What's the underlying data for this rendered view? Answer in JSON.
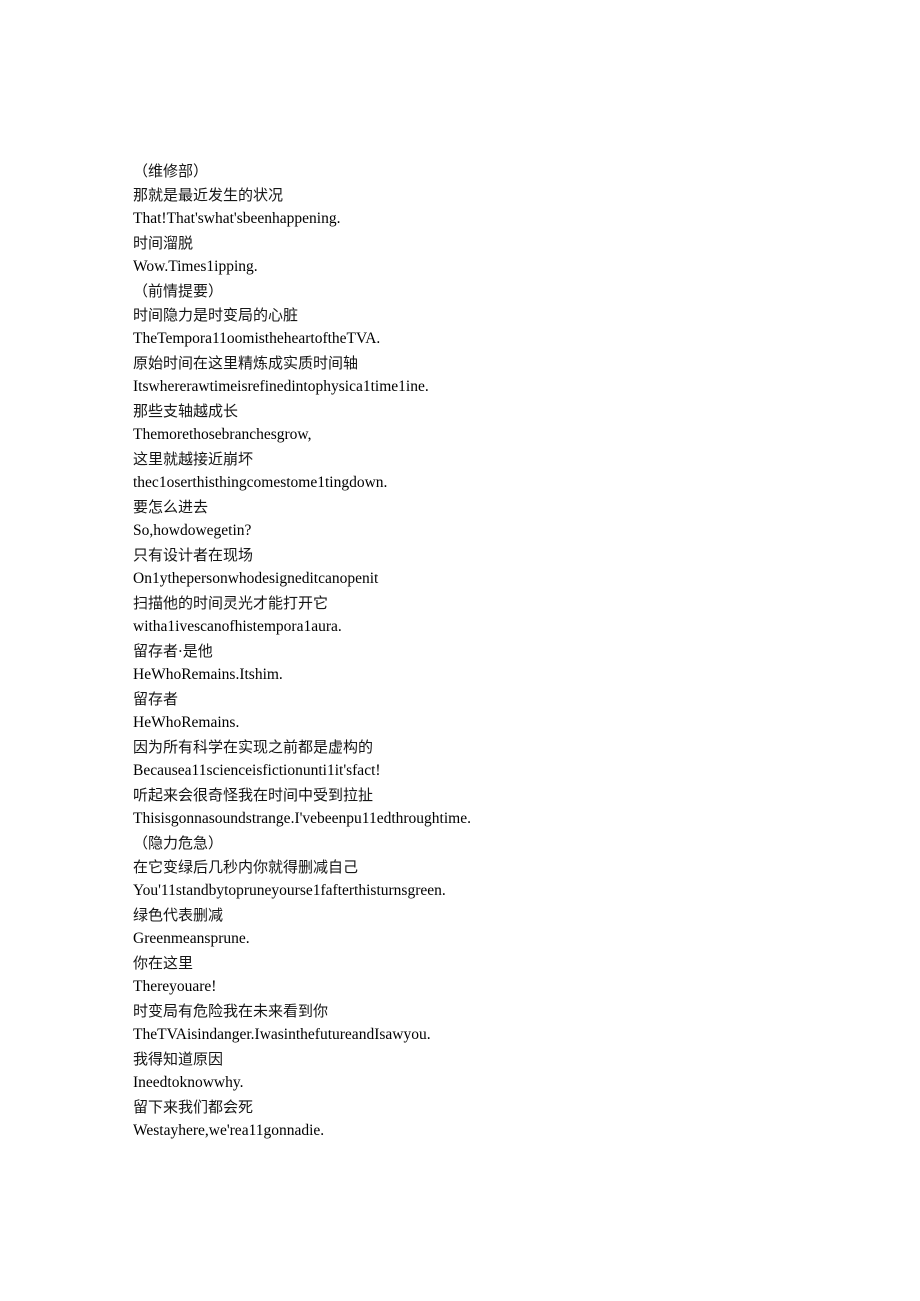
{
  "document": {
    "background_color": "#ffffff",
    "text_color": "#000000",
    "kind": "bilingual-subtitle-transcript"
  },
  "lines": [
    {
      "id": "l01",
      "lang": "zh",
      "paren": true,
      "text": "（维修部）"
    },
    {
      "id": "l02",
      "lang": "zh",
      "paren": false,
      "text": "那就是最近发生的状况"
    },
    {
      "id": "l03",
      "lang": "en",
      "paren": false,
      "text": "That!That'swhat'sbeenhappening."
    },
    {
      "id": "l04",
      "lang": "zh",
      "paren": false,
      "text": "时间溜脱"
    },
    {
      "id": "l05",
      "lang": "en",
      "paren": false,
      "text": "Wow.Times1ipping."
    },
    {
      "id": "l06",
      "lang": "zh",
      "paren": true,
      "text": "（前情提要）"
    },
    {
      "id": "l07",
      "lang": "zh",
      "paren": false,
      "text": "时间隐力是时变局的心脏"
    },
    {
      "id": "l08",
      "lang": "en",
      "paren": false,
      "text": "TheTempora11oomistheheartoftheTVA."
    },
    {
      "id": "l09",
      "lang": "zh",
      "paren": false,
      "text": "原始时间在这里精炼成实质时间轴"
    },
    {
      "id": "l10",
      "lang": "en",
      "paren": false,
      "text": "Itswhererawtimeisrefinedintophysica1time1ine."
    },
    {
      "id": "l11",
      "lang": "zh",
      "paren": false,
      "text": "那些支轴越成长"
    },
    {
      "id": "l12",
      "lang": "en",
      "paren": false,
      "text": "Themorethosebranchesgrow,"
    },
    {
      "id": "l13",
      "lang": "zh",
      "paren": false,
      "text": "这里就越接近崩坏"
    },
    {
      "id": "l14",
      "lang": "en",
      "paren": false,
      "text": "thec1oserthisthingcomestome1tingdown."
    },
    {
      "id": "l15",
      "lang": "zh",
      "paren": false,
      "text": "要怎么进去"
    },
    {
      "id": "l16",
      "lang": "en",
      "paren": false,
      "text": "So,howdowegetin?"
    },
    {
      "id": "l17",
      "lang": "zh",
      "paren": false,
      "text": "只有设计者在现场"
    },
    {
      "id": "l18",
      "lang": "en",
      "paren": false,
      "text": "On1ythepersonwhodesigneditcanopenit"
    },
    {
      "id": "l19",
      "lang": "zh",
      "paren": false,
      "text": "扫描他的时间灵光才能打开它"
    },
    {
      "id": "l20",
      "lang": "en",
      "paren": false,
      "text": "witha1ivescanofhistempora1aura."
    },
    {
      "id": "l21",
      "lang": "zh",
      "paren": false,
      "text": "留存者·是他"
    },
    {
      "id": "l22",
      "lang": "en",
      "paren": false,
      "text": "HeWhoRemains.Itshim."
    },
    {
      "id": "l23",
      "lang": "zh",
      "paren": false,
      "text": "留存者"
    },
    {
      "id": "l24",
      "lang": "en",
      "paren": false,
      "text": "HeWhoRemains."
    },
    {
      "id": "l25",
      "lang": "zh",
      "paren": false,
      "text": "因为所有科学在实现之前都是虚构的"
    },
    {
      "id": "l26",
      "lang": "en",
      "paren": false,
      "text": "Becausea11scienceisfictionunti1it'sfact!"
    },
    {
      "id": "l27",
      "lang": "zh",
      "paren": false,
      "text": "听起来会很奇怪我在时间中受到拉扯"
    },
    {
      "id": "l28",
      "lang": "en",
      "paren": false,
      "text": "Thisisgonnasoundstrange.I'vebeenpu11edthroughtime."
    },
    {
      "id": "l29",
      "lang": "zh",
      "paren": true,
      "text": "（隐力危急）"
    },
    {
      "id": "l30",
      "lang": "zh",
      "paren": false,
      "text": "在它变绿后几秒内你就得删减自己"
    },
    {
      "id": "l31",
      "lang": "en",
      "paren": false,
      "text": "You'11standbytopruneyourse1fafterthisturnsgreen."
    },
    {
      "id": "l32",
      "lang": "zh",
      "paren": false,
      "text": "绿色代表删减"
    },
    {
      "id": "l33",
      "lang": "en",
      "paren": false,
      "text": "Greenmeansprune."
    },
    {
      "id": "l34",
      "lang": "zh",
      "paren": false,
      "text": "你在这里"
    },
    {
      "id": "l35",
      "lang": "en",
      "paren": false,
      "text": "Thereyouare!"
    },
    {
      "id": "l36",
      "lang": "zh",
      "paren": false,
      "text": "时变局有危险我在未来看到你"
    },
    {
      "id": "l37",
      "lang": "en",
      "paren": false,
      "text": "TheTVAisindanger.IwasinthefutureandIsawyou."
    },
    {
      "id": "l38",
      "lang": "zh",
      "paren": false,
      "text": "我得知道原因"
    },
    {
      "id": "l39",
      "lang": "en",
      "paren": false,
      "text": "Ineedtoknowwhy."
    },
    {
      "id": "l40",
      "lang": "zh",
      "paren": false,
      "text": "留下来我们都会死"
    },
    {
      "id": "l41",
      "lang": "en",
      "paren": false,
      "text": "Westayhere,we'rea11gonnadie."
    }
  ]
}
